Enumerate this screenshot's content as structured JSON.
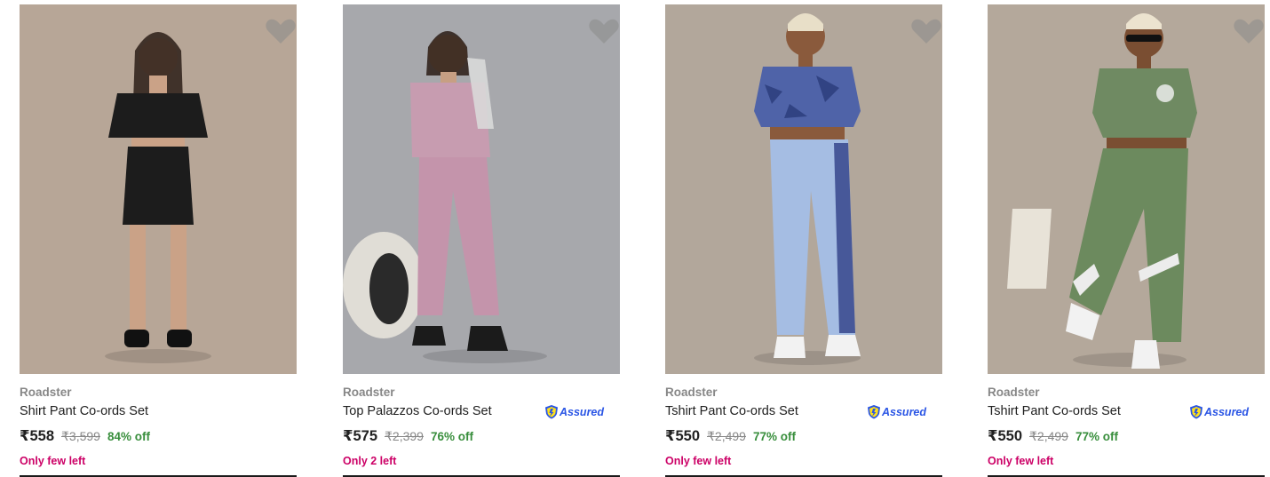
{
  "products": [
    {
      "brand": "Roadster",
      "title": "Shirt Pant Co-ords Set",
      "price": "₹558",
      "mrp": "₹3,599",
      "discount": "84% off",
      "stock": "Only few left",
      "assured": false,
      "bg": "#b7a697",
      "top_color": "#1c1c1c",
      "bottom_color": "#1c1c1c",
      "shoe_color": "#111111"
    },
    {
      "brand": "Roadster",
      "title": "Top Palazzos Co-ords Set",
      "price": "₹575",
      "mrp": "₹2,399",
      "discount": "76% off",
      "stock": "Only 2 left",
      "assured": true,
      "assured_label": "Assured",
      "bg": "#a7a8ac",
      "top_color": "#c79cb0",
      "bottom_color": "#c494ab",
      "shoe_color": "#1b1b1b"
    },
    {
      "brand": "Roadster",
      "title": "Tshirt Pant Co-ords Set",
      "price": "₹550",
      "mrp": "₹2,499",
      "discount": "77% off",
      "stock": "Only few left",
      "assured": true,
      "assured_label": "Assured",
      "bg": "#b2a79b",
      "top_color": "#4f63a8",
      "bottom_color": "#a5bde3",
      "shoe_color": "#f2f2f2"
    },
    {
      "brand": "Roadster",
      "title": "Tshirt Pant Co-ords Set",
      "price": "₹550",
      "mrp": "₹2,499",
      "discount": "77% off",
      "stock": "Only few left",
      "assured": true,
      "assured_label": "Assured",
      "bg": "#b4a89b",
      "top_color": "#6f8a62",
      "bottom_color": "#6c8a5e",
      "shoe_color": "#f2f2f2"
    }
  ],
  "icons": {
    "wishlist": "heart-icon",
    "assured": "assured-shield-icon"
  }
}
